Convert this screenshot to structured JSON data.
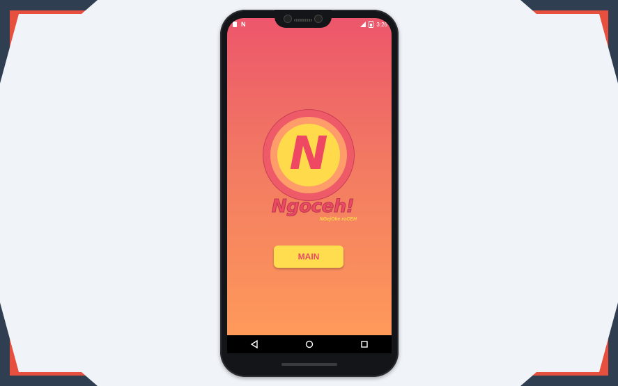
{
  "status_bar": {
    "time": "3:26",
    "left_icons": [
      "notification-icon",
      "n-app-icon"
    ],
    "right_icons": [
      "signal-icon",
      "battery-icon"
    ],
    "n_label": "N"
  },
  "app": {
    "logo_letter": "N",
    "title": "Ngoceh!",
    "tagline": "NGejOke roCEH",
    "main_button_label": "MAIN"
  },
  "navigation": {
    "buttons": [
      "back-icon",
      "home-icon",
      "recents-icon"
    ]
  },
  "colors": {
    "gradient_top": "#ed566b",
    "gradient_bottom": "#ff9b5a",
    "accent_yellow": "#ffdd4f",
    "accent_pink": "#ee4862",
    "frame_navy": "#2f3e51",
    "frame_red": "#e7503f",
    "frame_light": "#f0f4f9"
  }
}
